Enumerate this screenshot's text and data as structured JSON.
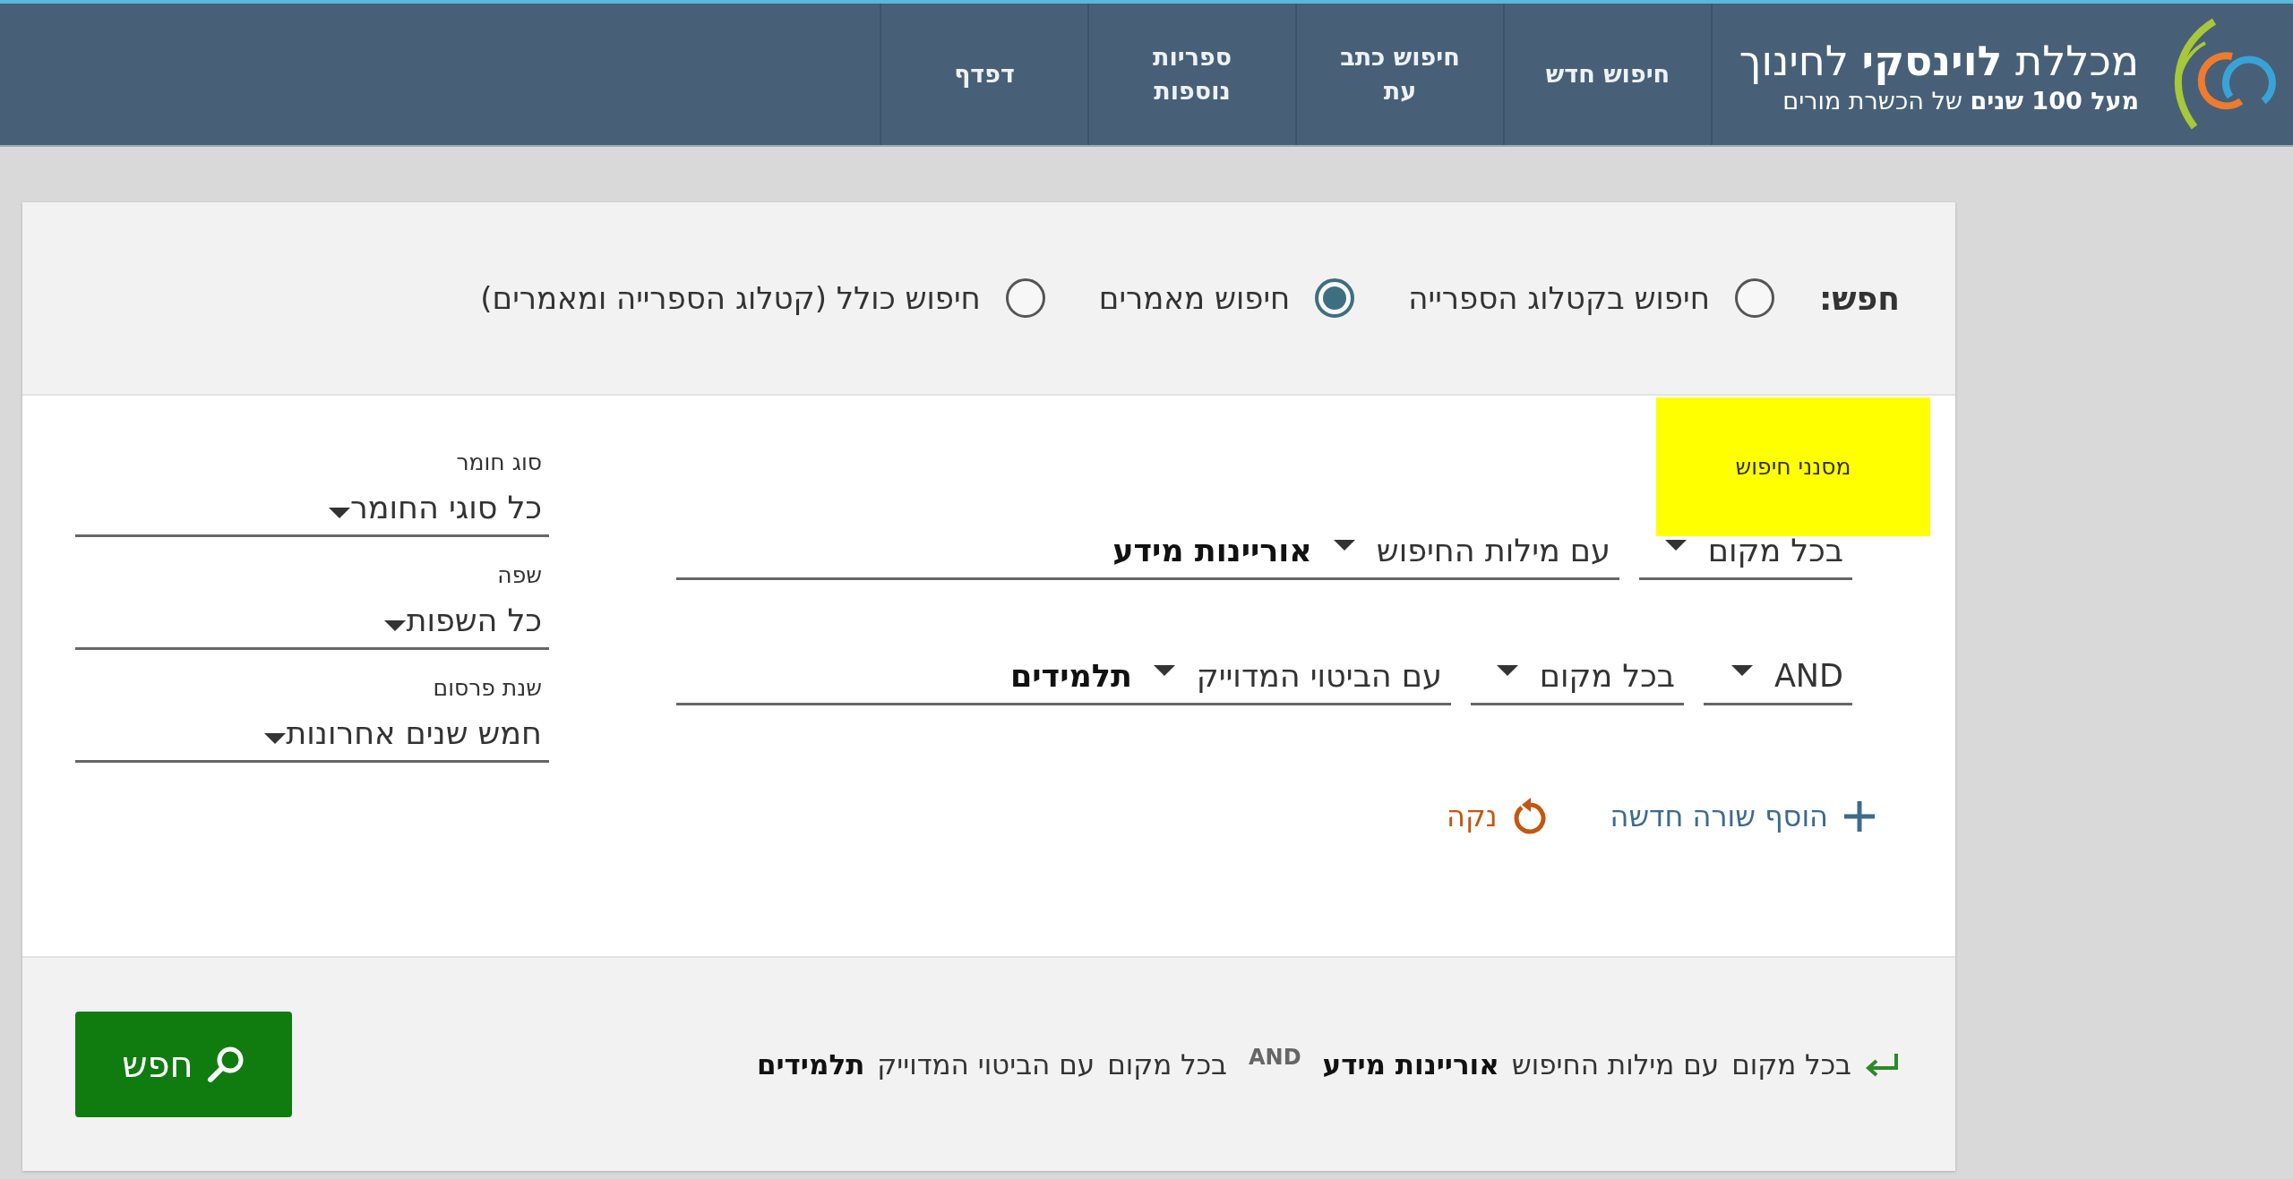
{
  "header": {
    "logo_title": "מכללת **לוינסקי** לחינוך",
    "logo_tagline": "**מעל 100 שנים** של הכשרת מורים",
    "nav": [
      {
        "label": "חיפוש חדש"
      },
      {
        "label": "חיפוש כתב עת"
      },
      {
        "label": "ספריות נוספות"
      },
      {
        "label": "דפדף"
      }
    ]
  },
  "search_type": {
    "label": "חפש:",
    "options": [
      {
        "label": "חיפוש בקטלוג הספרייה",
        "selected": false
      },
      {
        "label": "חיפוש מאמרים",
        "selected": true
      },
      {
        "label": "חיפוש כולל (קטלוג הספרייה ומאמרים)",
        "selected": false
      }
    ]
  },
  "filters_tooltip": "מסנני חיפוש",
  "query_rows": [
    {
      "scope": "בכל מקום",
      "operator": "עם מילות החיפוש",
      "value": "אוריינות מידע"
    },
    {
      "boolean": "AND",
      "scope": "בכל מקום",
      "operator": "עם הביטוי המדוייק",
      "value": "תלמידים"
    }
  ],
  "actions": {
    "add_row": "הוסף שורה חדשה",
    "clear": "נקה"
  },
  "filters": [
    {
      "label": "סוג חומר",
      "value": "כל סוגי החומר"
    },
    {
      "label": "שפה",
      "value": "כל השפות"
    },
    {
      "label": "שנת פרסום",
      "value": "חמש שנים אחרונות"
    }
  ],
  "summary": [
    {
      "kind": "term",
      "text": "בכל מקום"
    },
    {
      "kind": "term",
      "text": "עם מילות החיפוש"
    },
    {
      "kind": "value",
      "text": "אוריינות מידע"
    },
    {
      "kind": "boolean",
      "text": "AND"
    },
    {
      "kind": "term",
      "text": "בכל מקום"
    },
    {
      "kind": "term",
      "text": "עם הביטוי המדוייק"
    },
    {
      "kind": "value",
      "text": "תלמידים"
    }
  ],
  "search_button": "חפש"
}
